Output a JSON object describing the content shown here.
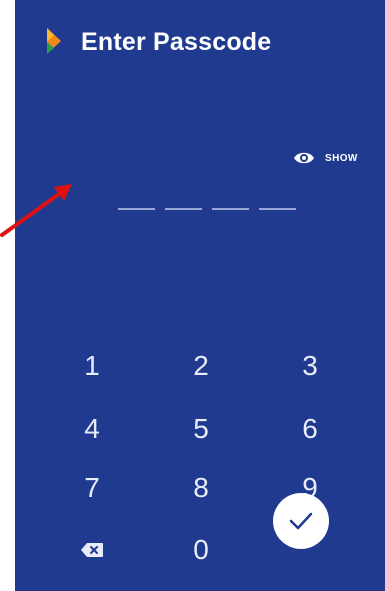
{
  "header": {
    "title": "Enter Passcode",
    "logo_icon": "brand-flag-icon"
  },
  "toggle": {
    "show_label": "SHOW",
    "icon": "eye-icon"
  },
  "passcode": {
    "length": 4,
    "entered": 0
  },
  "keypad": {
    "keys": [
      "1",
      "2",
      "3",
      "4",
      "5",
      "6",
      "7",
      "8",
      "9"
    ],
    "zero": "0",
    "backspace_icon": "backspace-icon",
    "submit_icon": "check-icon"
  },
  "colors": {
    "background": "#203a8f",
    "text": "#ffffff",
    "annotation_arrow": "#e01010"
  }
}
